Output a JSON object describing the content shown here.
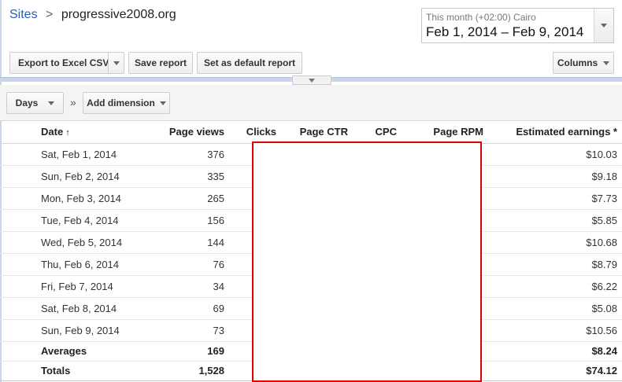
{
  "breadcrumb": {
    "root": "Sites",
    "separator": ">",
    "current": "progressive2008.org"
  },
  "date_picker": {
    "preset": "This month (+02:00) Cairo",
    "range": "Feb 1, 2014 – Feb 9, 2014"
  },
  "toolbar": {
    "export_label": "Export to Excel CSV",
    "save_label": "Save report",
    "default_label": "Set as default report",
    "columns_label": "Columns"
  },
  "dimensions": {
    "days_label": "Days",
    "separator": "»",
    "add_label": "Add dimension"
  },
  "table": {
    "headers": {
      "date": "Date",
      "sort_indicator": "↑",
      "page_views": "Page views",
      "clicks": "Clicks",
      "page_ctr": "Page CTR",
      "cpc": "CPC",
      "page_rpm": "Page RPM",
      "earnings": "Estimated earnings *"
    },
    "rows": [
      {
        "date": "Sat, Feb 1, 2014",
        "page_views": "376",
        "earnings": "$10.03"
      },
      {
        "date": "Sun, Feb 2, 2014",
        "page_views": "335",
        "earnings": "$9.18"
      },
      {
        "date": "Mon, Feb 3, 2014",
        "page_views": "265",
        "earnings": "$7.73"
      },
      {
        "date": "Tue, Feb 4, 2014",
        "page_views": "156",
        "earnings": "$5.85"
      },
      {
        "date": "Wed, Feb 5, 2014",
        "page_views": "144",
        "earnings": "$10.68"
      },
      {
        "date": "Thu, Feb 6, 2014",
        "page_views": "76",
        "earnings": "$8.79"
      },
      {
        "date": "Fri, Feb 7, 2014",
        "page_views": "34",
        "earnings": "$6.22"
      },
      {
        "date": "Sat, Feb 8, 2014",
        "page_views": "69",
        "earnings": "$5.08"
      },
      {
        "date": "Sun, Feb 9, 2014",
        "page_views": "73",
        "earnings": "$10.56"
      }
    ],
    "averages": {
      "label": "Averages",
      "page_views": "169",
      "earnings": "$8.24"
    },
    "totals": {
      "label": "Totals",
      "page_views": "1,528",
      "earnings": "$74.12"
    }
  },
  "colors": {
    "link": "#2a5db0",
    "redaction_border": "#e00000"
  }
}
